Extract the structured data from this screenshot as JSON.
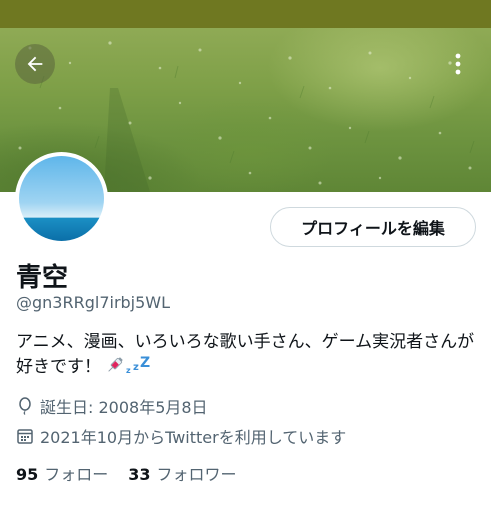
{
  "header": {
    "back_icon": "arrow-left-icon",
    "more_icon": "more-vertical-icon",
    "status_color": "#6f7821"
  },
  "profile": {
    "display_name": "青空",
    "handle": "@gn3RRgl7irbj5WL",
    "edit_button_label": "プロフィールを編集",
    "bio": "アニメ、漫画、いろいろな歌い手さん、ゲーム実況者さんが好きです！",
    "bio_emoji": [
      "syringe-icon",
      "sleep-zzz-icon"
    ],
    "birthday": {
      "icon": "balloon-icon",
      "text": "誕生日: 2008年5月8日"
    },
    "joined": {
      "icon": "calendar-icon",
      "text": "2021年10月からTwitterを利用しています"
    },
    "following": {
      "count": "95",
      "label": "フォロー"
    },
    "followers": {
      "count": "33",
      "label": "フォロワー"
    }
  },
  "colors": {
    "text_primary": "#0f1419",
    "text_secondary": "#536471",
    "border": "#cfd9de"
  }
}
